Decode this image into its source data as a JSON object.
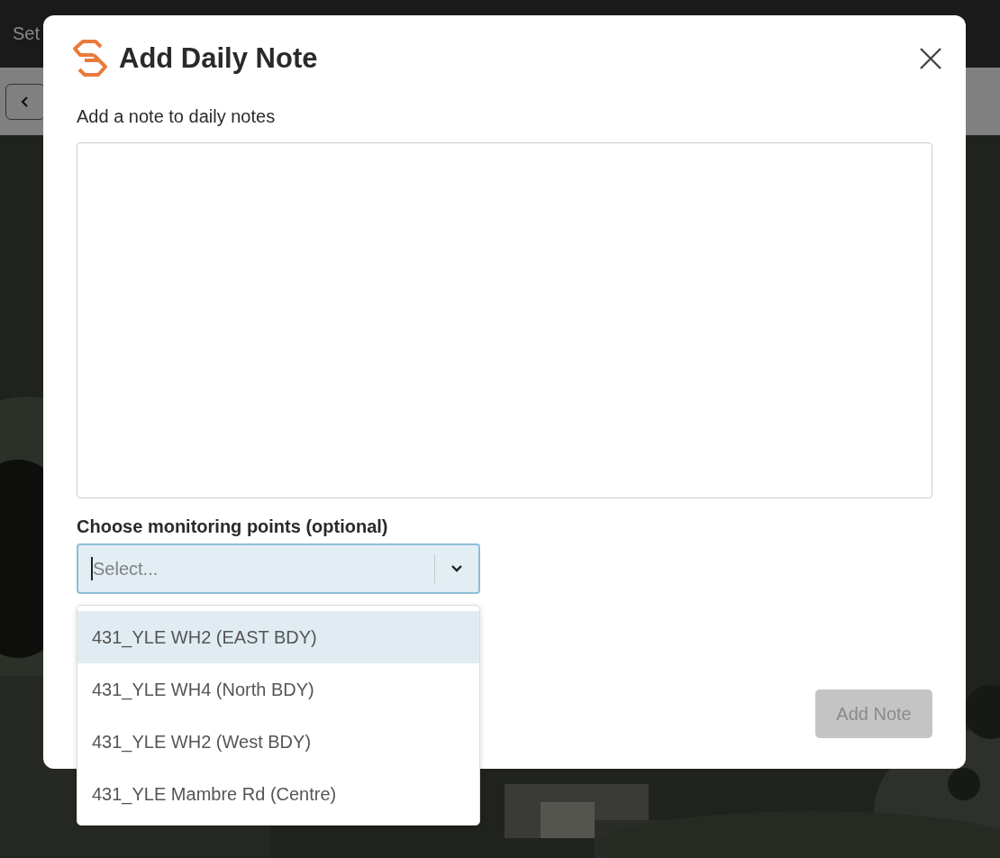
{
  "background": {
    "top_bar_text": "Set"
  },
  "dialog": {
    "title": "Add Daily Note",
    "note_label": "Add a note to daily notes",
    "points_label": "Choose monitoring points (optional)",
    "select": {
      "placeholder": "Select...",
      "focused": true
    },
    "options": [
      {
        "label": "431_YLE WH2 (EAST BDY)",
        "selected": true
      },
      {
        "label": "431_YLE WH4 (North BDY)",
        "selected": false
      },
      {
        "label": "431_YLE WH2 (West BDY)",
        "selected": false
      },
      {
        "label": "431_YLE Mambre Rd (Centre)",
        "selected": false
      }
    ],
    "submit": {
      "label": "Add Note",
      "disabled": true
    }
  }
}
